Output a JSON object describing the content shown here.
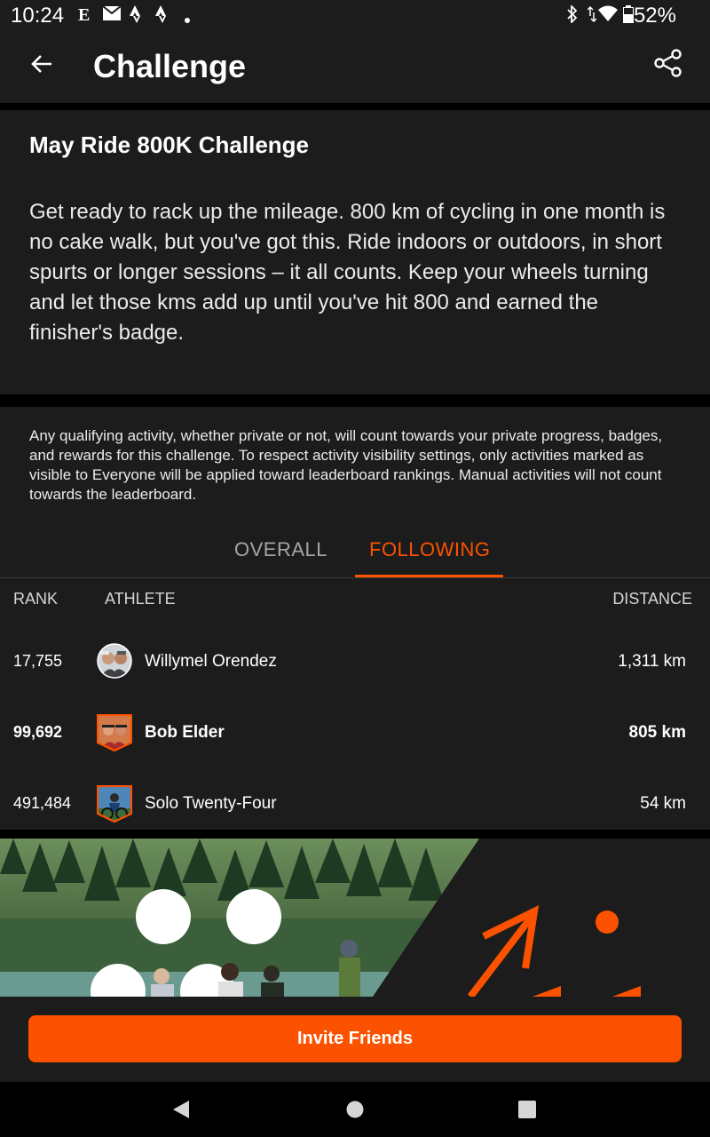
{
  "status_bar": {
    "time": "10:24",
    "battery": "52%",
    "notification_icons": [
      "etsy-icon",
      "mail-icon",
      "strava-icon",
      "strava-icon",
      "dot-icon"
    ],
    "system_icons": [
      "bluetooth-icon",
      "data-arrows-icon",
      "wifi-icon",
      "battery-icon"
    ]
  },
  "app_bar": {
    "title": "Challenge",
    "back_icon": "arrow-left-icon",
    "share_icon": "share-icon"
  },
  "challenge": {
    "name": "May Ride 800K Challenge",
    "description": "Get ready to rack up the mileage. 800 km of cycling in one month is no cake walk, but you've got this. Ride indoors or outdoors, in short spurts or longer sessions – it all counts. Keep your wheels turning and let those kms add up until you've hit 800 and earned the finisher's badge."
  },
  "notice": "Any qualifying activity, whether private or not, will count towards your private progress, badges, and rewards for this challenge. To respect activity visibility settings, only activities marked as visible to Everyone will be applied toward leaderboard rankings. Manual activities will not count towards the leaderboard.",
  "tabs": [
    {
      "label": "OVERALL",
      "active": false
    },
    {
      "label": "FOLLOWING",
      "active": true
    }
  ],
  "leaderboard": {
    "headers": {
      "rank": "RANK",
      "athlete": "ATHLETE",
      "distance": "DISTANCE"
    },
    "rows": [
      {
        "rank": "17,755",
        "athlete": "Willymel Orendez",
        "distance": "1,311 km",
        "current_user": false
      },
      {
        "rank": "99,692",
        "athlete": "Bob Elder",
        "distance": "805 km",
        "current_user": true
      },
      {
        "rank": "491,484",
        "athlete": "Solo Twenty-Four",
        "distance": "54 km",
        "current_user": false
      }
    ]
  },
  "invite_button": "Invite Friends",
  "colors": {
    "accent": "#fc5200",
    "surface": "#1c1c1c",
    "background": "#000000"
  }
}
